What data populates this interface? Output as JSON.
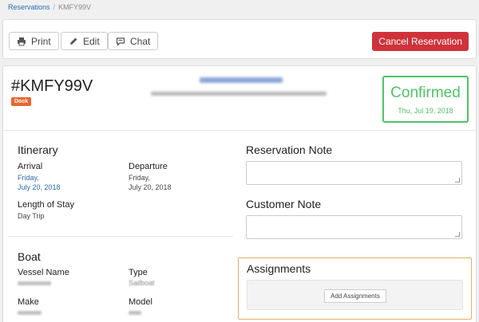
{
  "breadcrumb": {
    "parent": "Reservations",
    "separator": "/",
    "current": "KMFY99V"
  },
  "toolbar": {
    "print_label": "Print",
    "edit_label": "Edit",
    "chat_label": "Chat",
    "cancel_label": "Cancel Reservation",
    "cancel_color": "#d0323a"
  },
  "reservation": {
    "id": "#KMFY99V",
    "badge": "Dock",
    "badge_color": "#e9662d"
  },
  "status": {
    "label": "Confirmed",
    "date": "Thu, Jul 19, 2018",
    "color": "#4dc466"
  },
  "itinerary": {
    "title": "Itinerary",
    "arrival_label": "Arrival",
    "arrival_line1": "Friday,",
    "arrival_line2": "July 20, 2018",
    "departure_label": "Departure",
    "departure_line1": "Friday,",
    "departure_line2": "July 20, 2018",
    "stay_label": "Length of Stay",
    "stay_value": "Day Trip"
  },
  "boat": {
    "title": "Boat",
    "vessel_label": "Vessel Name",
    "type_label": "Type",
    "type_value": "Sailboat",
    "make_label": "Make",
    "model_label": "Model"
  },
  "notes": {
    "reservation_title": "Reservation Note",
    "customer_title": "Customer Note"
  },
  "assignments": {
    "title": "Assignments",
    "button_label": "Add Assignments",
    "border_color": "#e2b06a"
  }
}
